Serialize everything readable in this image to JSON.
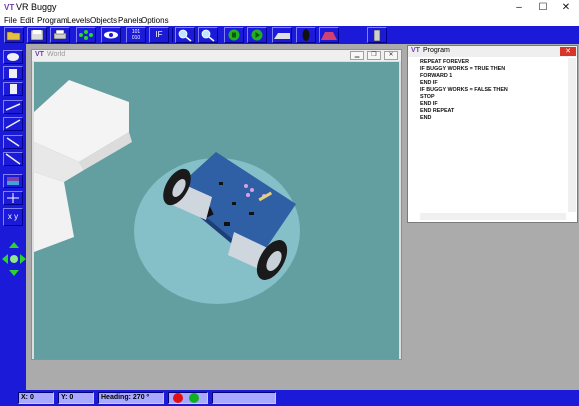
{
  "window": {
    "title": "VR Buggy",
    "minimize": "–",
    "maximize": "☐",
    "close": "✕"
  },
  "menu": [
    "File",
    "Edit",
    "Program",
    "Levels",
    "Objects",
    "Panels",
    "Options"
  ],
  "toolbar": {
    "icons": [
      "open-folder-icon",
      "save-icon",
      "print-icon",
      "network-icon",
      "eye-icon",
      "binary-icon",
      "if-icon",
      "zoom-in-icon",
      "zoom-out-icon",
      "stop-icon",
      "play-icon",
      "flat-surface-icon",
      "wheel-icon",
      "ramp-icon",
      "door-icon"
    ],
    "binary_label": "101 010",
    "if_label": "IF"
  },
  "sidebar": {
    "icons": [
      "block-icon",
      "cylinder-icon",
      "tall-block-icon",
      "line-tool-1-icon",
      "line-tool-2-icon",
      "line-tool-3-icon",
      "line-tool-4-icon",
      "texture-icon",
      "crosshair-icon",
      "xy-icon"
    ],
    "xy_label": "x y"
  },
  "world": {
    "title": "World",
    "colors": {
      "floor": "#639ea0",
      "board": "#2f5fa5",
      "platform": "#8bc6cf"
    }
  },
  "program": {
    "title": "Program",
    "lines": [
      "REPEAT FOREVER",
      "IF BUGGY WORKS = TRUE THEN",
      "FORWARD 1",
      "END IF",
      "IF BUGGY WORKS = FALSE THEN",
      "STOP",
      "END IF",
      "END REPEAT",
      "END"
    ]
  },
  "status": {
    "x": "X: 0",
    "y": "Y: 0",
    "heading": "Heading:",
    "heading_value": "270 º",
    "record_color": "#e01010",
    "go_color": "#10b020"
  },
  "colors": {
    "accent": "#1a1ad8"
  }
}
